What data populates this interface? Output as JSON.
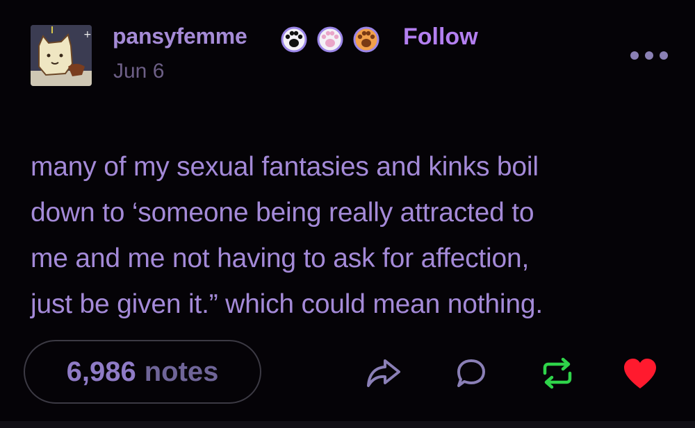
{
  "post": {
    "username": "pansyfemme",
    "follow_label": "Follow",
    "date": "Jun 6",
    "body_lines": [
      "many of my sexual fantasies and kinks boil",
      "down to ‘someone being really attracted to",
      "me and me not having to ask for affection,",
      "just be given it.” which could mean nothing."
    ],
    "notes_count": "6,986",
    "notes_label": "notes"
  },
  "badges": [
    {
      "icon": "paw-badge-dark-icon",
      "color": "#1a1a1a"
    },
    {
      "icon": "paw-badge-pink-icon",
      "color": "#e9a6c8"
    },
    {
      "icon": "paw-badge-brown-icon",
      "color": "#8a4a1e"
    }
  ],
  "colors": {
    "background": "#050307",
    "accent": "#b37ff0",
    "text": "#a48ad8",
    "reblog": "#2fd44a",
    "like": "#ff1a2e"
  },
  "actions": [
    "share-icon",
    "reply-icon",
    "reblog-icon",
    "like-heart-icon"
  ]
}
